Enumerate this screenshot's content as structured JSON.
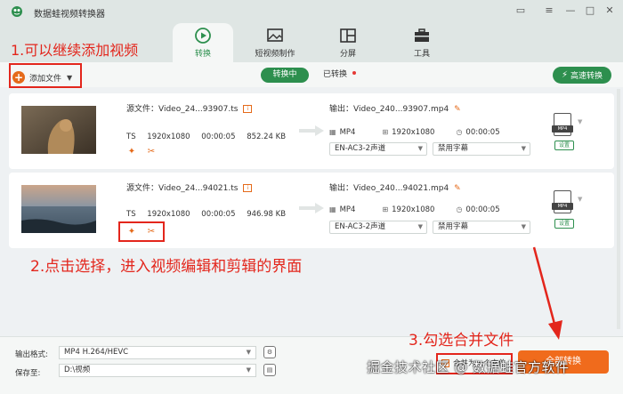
{
  "app": {
    "title": "数据蛙视频转换器"
  },
  "nav": {
    "tabs": [
      {
        "label": "转换",
        "icon": "convert-icon",
        "active": true
      },
      {
        "label": "短视频制作",
        "icon": "image-icon",
        "active": false
      },
      {
        "label": "分屏",
        "icon": "split-screen-icon",
        "active": false
      },
      {
        "label": "工具",
        "icon": "toolbox-icon",
        "active": false
      }
    ]
  },
  "toolbar": {
    "add_file_label": "添加文件",
    "converting_label": "转换中",
    "converted_label": "已转换",
    "fast_convert_label": "高速转换"
  },
  "files": [
    {
      "source_label": "源文件：Video_24...93907.ts",
      "format": "TS",
      "resolution": "1920x1080",
      "duration": "00:00:05",
      "size": "852.24 KB",
      "output_label": "输出：Video_240...93907.mp4",
      "out_format": "MP4",
      "out_resolution": "1920x1080",
      "out_duration": "00:00:05",
      "audio_option": "EN-AC3-2声道",
      "subtitle_option": "禁用字幕",
      "format_badge": "MP4",
      "settings_label": "设置"
    },
    {
      "source_label": "源文件：Video_24...94021.ts",
      "format": "TS",
      "resolution": "1920x1080",
      "duration": "00:00:05",
      "size": "946.98 KB",
      "output_label": "输出：Video_240...94021.mp4",
      "out_format": "MP4",
      "out_resolution": "1920x1080",
      "out_duration": "00:00:05",
      "audio_option": "EN-AC3-2声道",
      "subtitle_option": "禁用字幕",
      "format_badge": "MP4",
      "settings_label": "设置"
    }
  ],
  "bottom": {
    "output_format_label": "输出格式:",
    "output_format_value": "MP4 H.264/HEVC",
    "save_to_label": "保存至:",
    "save_to_value": "D:\\视频",
    "merge_label": "合并为一个文件",
    "convert_all_label": "全部转换"
  },
  "annotations": {
    "step1": "1.可以继续添加视频",
    "step2": "2.点击选择，进入视频编辑和剪辑的界面",
    "step3": "3.勾选合并文件"
  },
  "watermark": "掘金技术社区 @ 数据蛙官方软件",
  "colors": {
    "accent_green": "#2d8f4e",
    "accent_orange": "#f06b1c",
    "annotation_red": "#e3261c"
  }
}
